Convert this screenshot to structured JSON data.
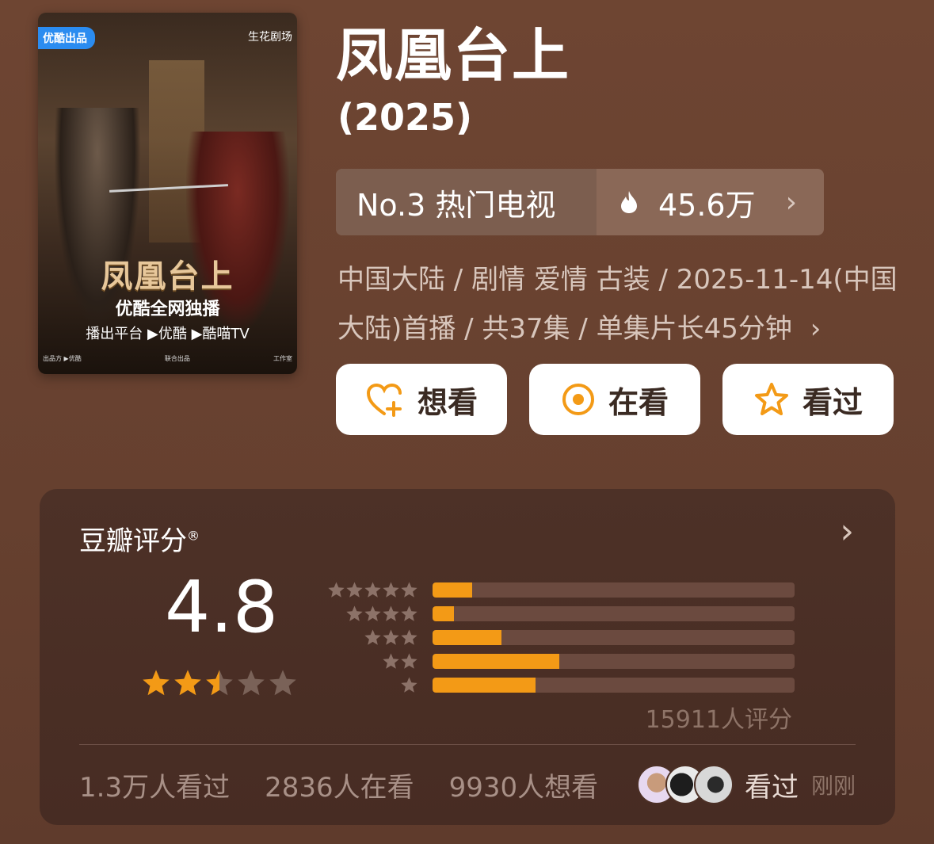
{
  "poster": {
    "badge_left": "优酷出品",
    "badge_right": "生花剧场",
    "title": "凤凰台上",
    "line1": "优酷全网独播",
    "line2": "播出平台 ▶优酷 ▶酷喵TV",
    "footer_left": "出品方 ▶优酷",
    "footer_mid": "联合出品",
    "footer_right": "工作室"
  },
  "header": {
    "title": "凤凰台上",
    "year": "(2025)"
  },
  "rank": {
    "label": "No.3 热门电视",
    "heat": "45.6万"
  },
  "meta": {
    "text": "中国大陆 / 剧情 爱情 古装 / 2025-11-14(中国大陆)首播 / 共37集 / 单集片长45分钟"
  },
  "actions": {
    "want": "想看",
    "watching": "在看",
    "watched": "看过"
  },
  "rating": {
    "header": "豆瓣评分",
    "score": "4.8",
    "stars_value": 2.5,
    "distribution": [
      {
        "stars": 5,
        "fraction": 0.11
      },
      {
        "stars": 4,
        "fraction": 0.06
      },
      {
        "stars": 3,
        "fraction": 0.19
      },
      {
        "stars": 2,
        "fraction": 0.35
      },
      {
        "stars": 1,
        "fraction": 0.285
      }
    ],
    "count_text": "15911人评分"
  },
  "stats": {
    "watched": "1.3万人看过",
    "watching": "2836人在看",
    "want": "9930人想看",
    "friend_label": "看过",
    "friend_time": "刚刚"
  },
  "colors": {
    "accent": "#f39a16",
    "background": "#6b4330",
    "card": "#4c3026"
  }
}
